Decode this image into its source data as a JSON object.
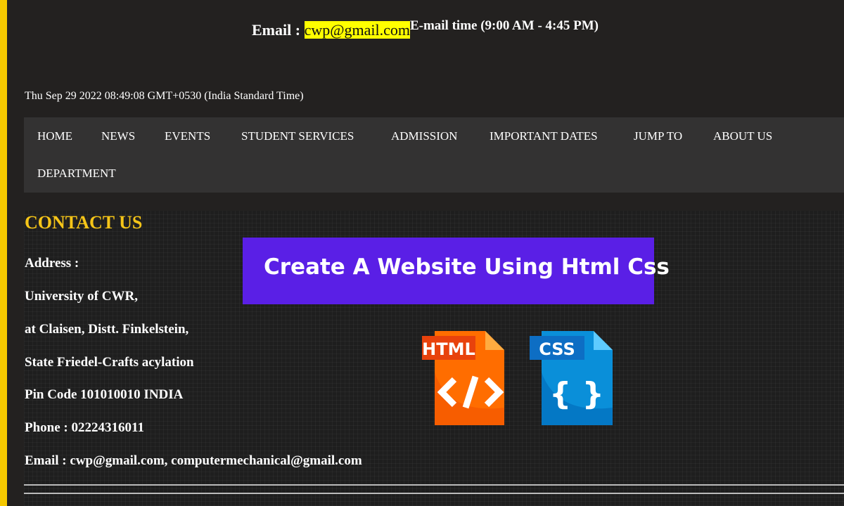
{
  "header": {
    "email_label": "Email : ",
    "email_value": "cwp@gmail.com",
    "email_time": "E-mail time (9:00 AM - 4:45 PM)",
    "datetime": "Thu Sep 29 2022 08:49:08 GMT+0530 (India Standard Time)"
  },
  "nav": {
    "items": [
      "HOME",
      "NEWS",
      "EVENTS",
      "STUDENT SERVICES",
      "ADMISSION",
      "IMPORTANT DATES",
      "JUMP TO",
      "ABOUT US",
      "DEPARTMENT"
    ]
  },
  "contact": {
    "title": "CONTACT US",
    "lines": [
      "Address :",
      "University of CWR,",
      "at Claisen, Distt. Finkelstein,",
      "State Friedel-Crafts acylation",
      "Pin Code 101010010 INDIA",
      "Phone : 02224316011",
      "Email : cwp@gmail.com, computermechanical@gmail.com"
    ]
  },
  "banner": {
    "text": "Create A Website Using Html Css"
  },
  "icons": {
    "html_label": "HTML",
    "css_label": "CSS"
  },
  "colors": {
    "accent_yellow": "#f5c518",
    "highlight": "#ffff00",
    "banner": "#5a1fe6",
    "html_orange": "#ff6d00",
    "css_blue": "#0a8fd9"
  }
}
